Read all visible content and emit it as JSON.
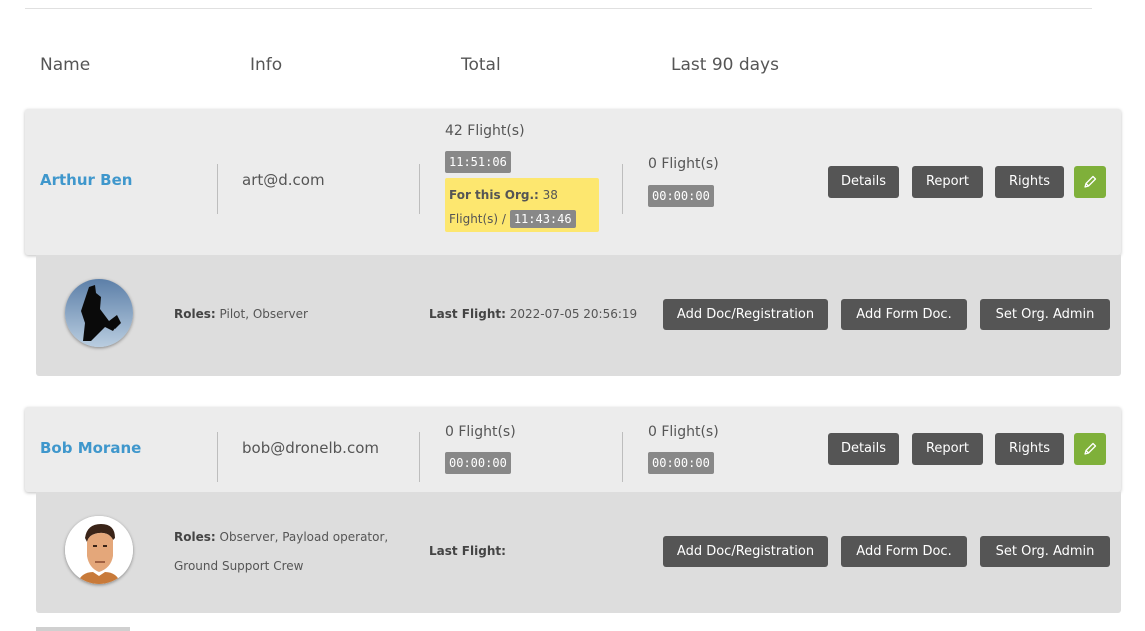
{
  "columns": {
    "name": "Name",
    "info": "Info",
    "total": "Total",
    "last90": "Last 90 days"
  },
  "users": [
    {
      "name": "Arthur Ben",
      "email": "art@d.com",
      "total_flights": "42 Flight(s)",
      "total_time": "11:51:06",
      "org_label": "For this Org.:",
      "org_count": "38",
      "org_flights_label": "Flight(s) /",
      "org_time": "11:43:46",
      "last90_flights": "0 Flight(s)",
      "last90_time": "00:00:00",
      "roles_label": "Roles:",
      "roles": "Pilot, Observer",
      "last_flight_label": "Last Flight:",
      "last_flight": "2022-07-05 20:56:19"
    },
    {
      "name": "Bob Morane",
      "email": "bob@dronelb.com",
      "total_flights": "0 Flight(s)",
      "total_time": "00:00:00",
      "last90_flights": "0 Flight(s)",
      "last90_time": "00:00:00",
      "roles_label": "Roles:",
      "roles_line1": "Observer, Payload operator,",
      "roles_line2": "Ground Support Crew",
      "last_flight_label": "Last Flight:",
      "last_flight": ""
    }
  ],
  "buttons": {
    "details": "Details",
    "report": "Report",
    "rights": "Rights",
    "add_doc": "Add Doc/Registration",
    "add_form": "Add Form Doc.",
    "set_admin": "Set Org. Admin"
  },
  "icons": {
    "edit": "pencil-icon"
  },
  "colors": {
    "name_link": "#3f97cc",
    "edit_button": "#7fb03a",
    "org_highlight": "#fde76f"
  }
}
